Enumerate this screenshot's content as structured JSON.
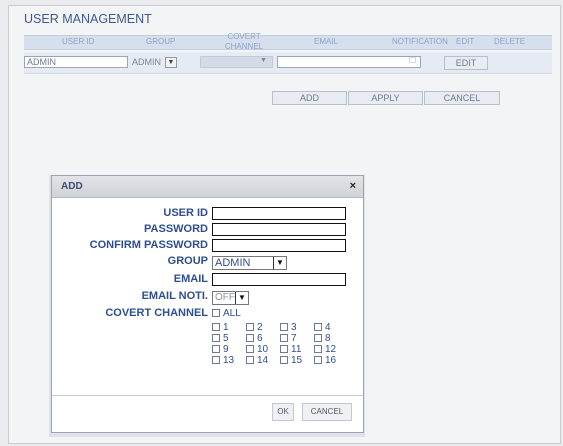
{
  "page": {
    "title": "USER MANAGEMENT"
  },
  "table": {
    "headers": [
      "USER ID",
      "GROUP",
      "COVERT CHANNEL",
      "EMAIL",
      "NOTIFICATION",
      "EDIT",
      "DELETE"
    ],
    "row": {
      "user_id": "ADMIN",
      "group": "ADMIN",
      "edit_label": "EDIT"
    }
  },
  "actions": {
    "add": "ADD",
    "apply": "APPLY",
    "cancel": "CANCEL"
  },
  "dialog": {
    "title": "ADD",
    "close": "×",
    "labels": {
      "user_id": "USER ID",
      "password": "PASSWORD",
      "confirm_password": "CONFIRM PASSWORD",
      "group": "GROUP",
      "email": "EMAIL",
      "email_noti": "EMAIL NOTI.",
      "covert_channel": "COVERT CHANNEL"
    },
    "values": {
      "user_id": "",
      "password": "",
      "confirm_password": "",
      "group": "ADMIN",
      "email": "",
      "email_noti": "OFF"
    },
    "channels_all": "ALL",
    "channels": [
      [
        "1",
        "2",
        "3",
        "4"
      ],
      [
        "5",
        "6",
        "7",
        "8"
      ],
      [
        "9",
        "10",
        "11",
        "12"
      ],
      [
        "13",
        "14",
        "15",
        "16"
      ]
    ],
    "ok": "OK",
    "cancel": "CANCEL"
  },
  "icons": {
    "dropdown": "chevron-down-icon",
    "close": "close-icon"
  }
}
